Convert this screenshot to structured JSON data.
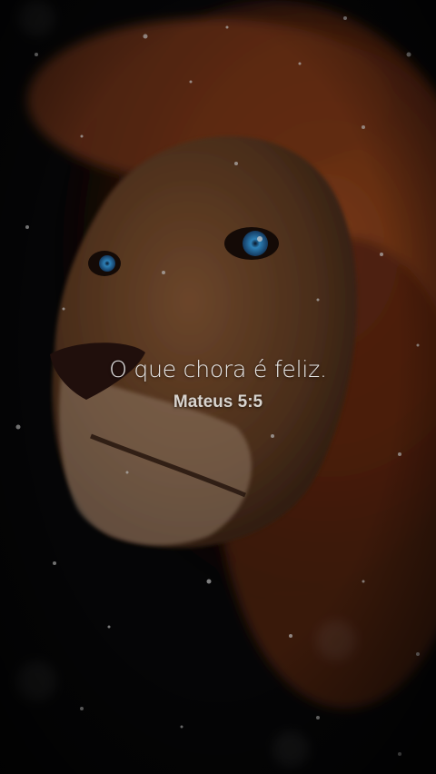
{
  "wallpaper": {
    "subject": "lion-with-blue-eyes-in-snow",
    "colors": {
      "mane": "#7a3a18",
      "fur": "#6e4326",
      "eye": "#3fa0e0",
      "background": "#070708"
    }
  },
  "verse": {
    "text": "O que chora é feliz.",
    "reference": "Mateus 5:5"
  }
}
